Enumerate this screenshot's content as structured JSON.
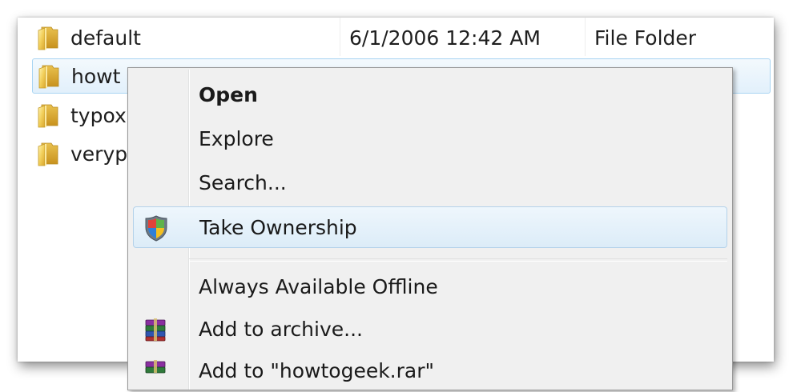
{
  "files": [
    {
      "name": "default",
      "date": "6/1/2006 12:42 AM",
      "type": "File Folder",
      "icon": "folder-icon"
    },
    {
      "name": "howt",
      "date": "",
      "type": "",
      "icon": "folder-icon"
    },
    {
      "name": "typox",
      "date": "",
      "type": "",
      "icon": "folder-icon"
    },
    {
      "name": "veryp",
      "date": "",
      "type": "",
      "icon": "folder-icon"
    }
  ],
  "context_menu": {
    "items": [
      {
        "label": "Open",
        "bold": true
      },
      {
        "label": "Explore"
      },
      {
        "label": "Search..."
      },
      {
        "label": "Take Ownership",
        "icon": "uac-shield-icon",
        "highlighted": true
      },
      {
        "label": "Always Available Offline"
      },
      {
        "label": "Add to archive...",
        "icon": "winrar-archive-icon"
      },
      {
        "label": "Add to \"howtogeek.rar\"",
        "icon": "winrar-archive-icon"
      }
    ]
  },
  "colors": {
    "selection_border": "#a8d4f2",
    "menu_background": "#f0f0f0",
    "menu_hover_border": "#b4d2ea"
  }
}
